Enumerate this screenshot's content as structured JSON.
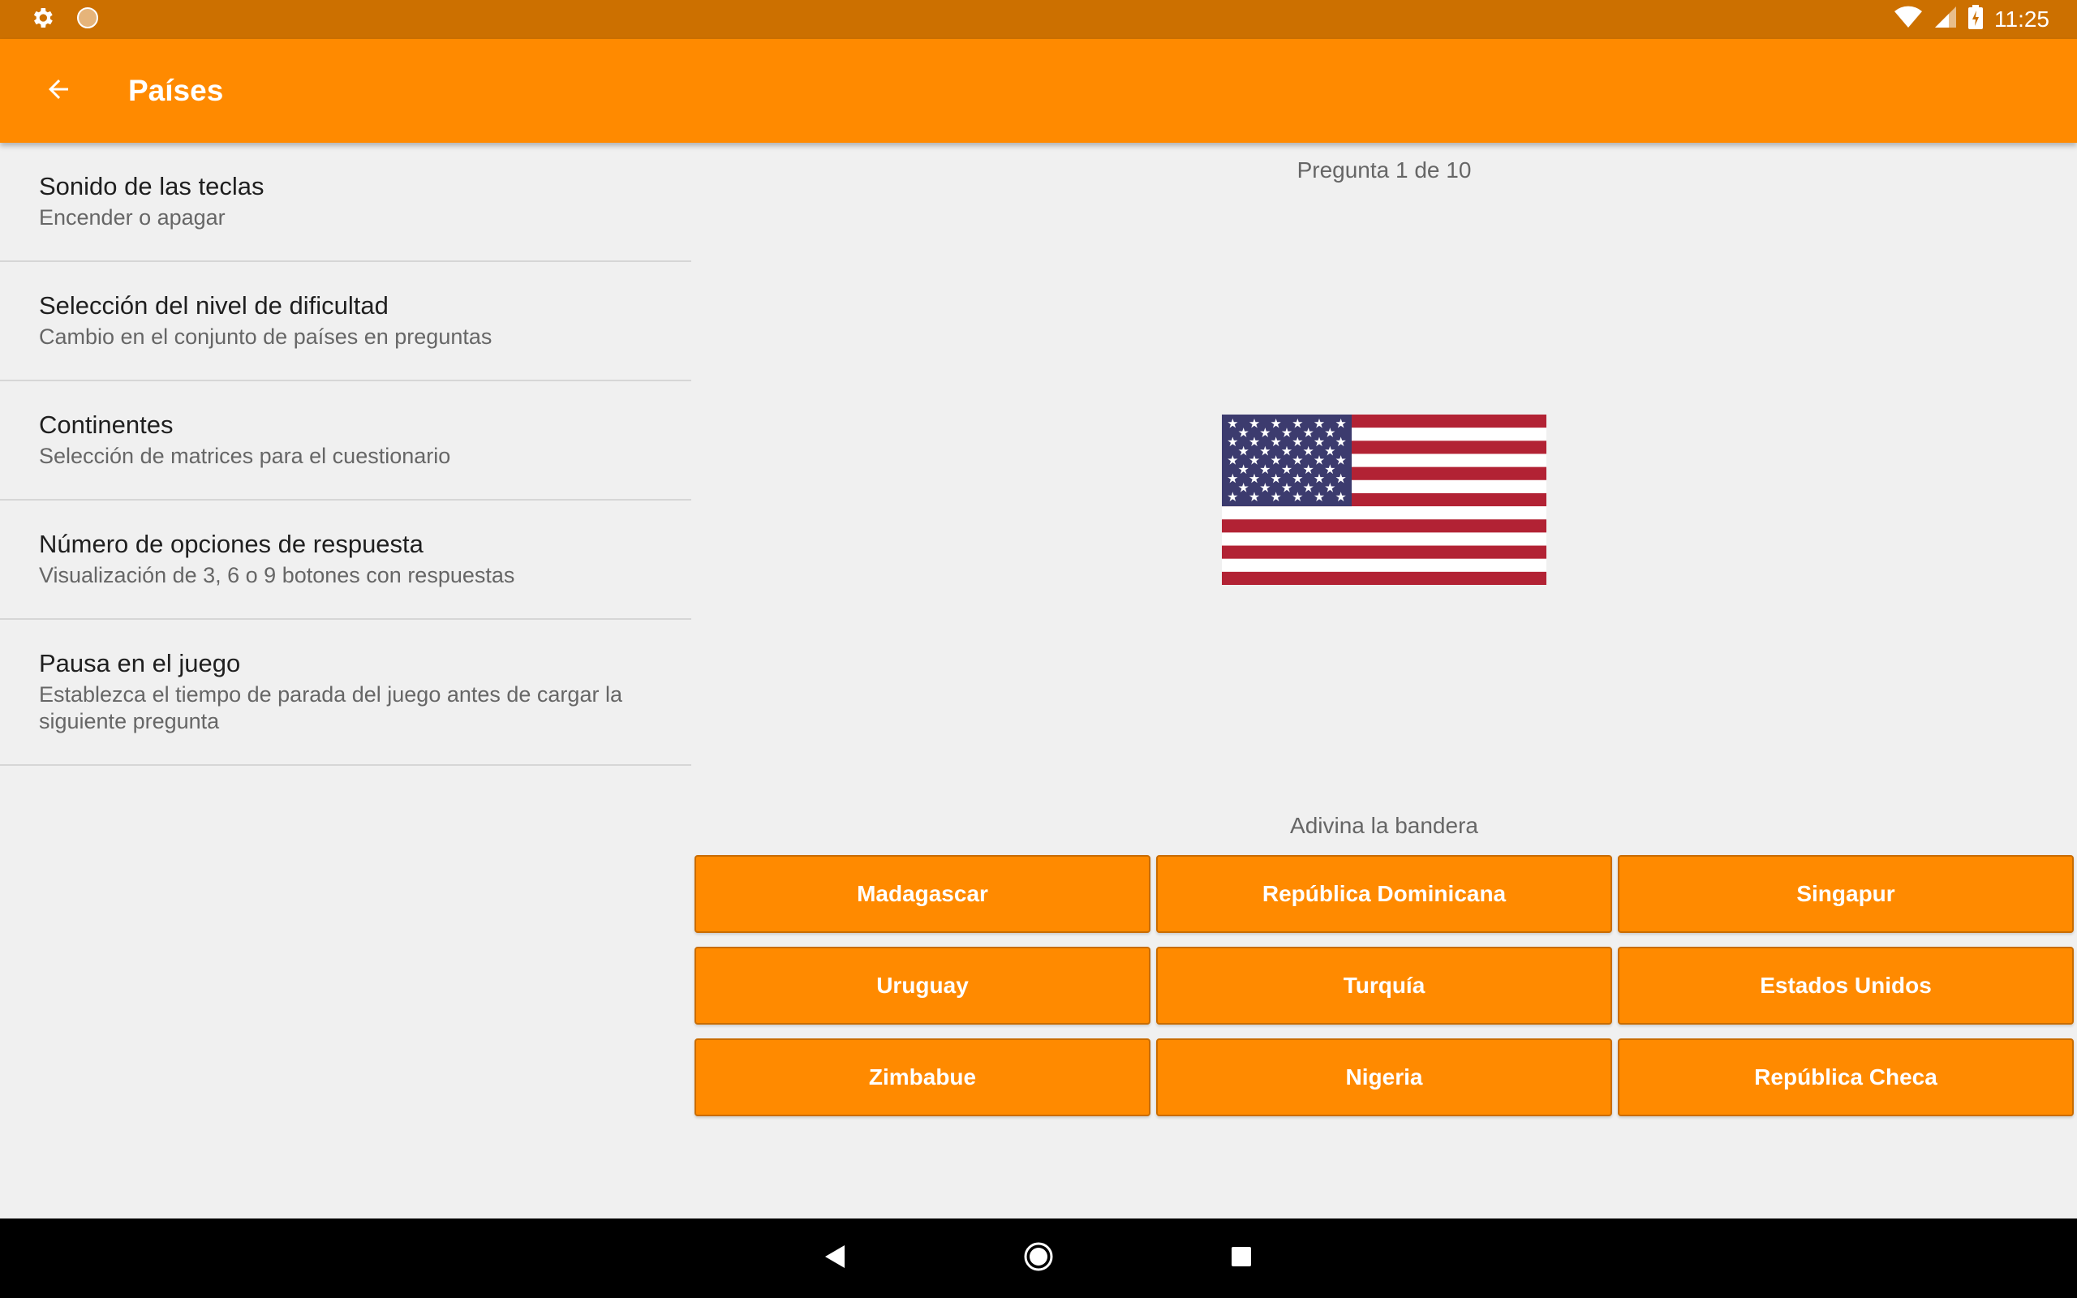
{
  "status_bar": {
    "time": "11:25",
    "icons": [
      "gear-icon",
      "circle-app-icon",
      "wifi-icon",
      "signal-icon",
      "battery-charging-icon"
    ]
  },
  "app_bar": {
    "title": "Países",
    "back_icon": "arrow-back-icon",
    "color": "#ff8a00",
    "status_color": "#cc7000"
  },
  "settings": {
    "items": [
      {
        "title": "Sonido de las teclas",
        "subtitle": "Encender o apagar"
      },
      {
        "title": "Selección del nivel de dificultad",
        "subtitle": "Cambio en el conjunto de países en preguntas"
      },
      {
        "title": "Continentes",
        "subtitle": "Selección de matrices para el cuestionario"
      },
      {
        "title": "Número de opciones de respuesta",
        "subtitle": "Visualización de 3, 6 o 9 botones con respuestas"
      },
      {
        "title": "Pausa en el juego",
        "subtitle": "Establezca el tiempo de parada del juego antes de cargar la siguiente pregunta"
      }
    ]
  },
  "quiz": {
    "counter": "Pregunta 1 de 10",
    "flag": "united-states-flag",
    "prompt": "Adivina la bandera",
    "answers": [
      "Madagascar",
      "República Dominicana",
      "Singapur",
      "Uruguay",
      "Turquía",
      "Estados Unidos",
      "Zimbabue",
      "Nigeria",
      "República Checa"
    ]
  },
  "nav_bar": {
    "icons": [
      "back-triangle-icon",
      "home-circle-icon",
      "recents-square-icon"
    ]
  }
}
